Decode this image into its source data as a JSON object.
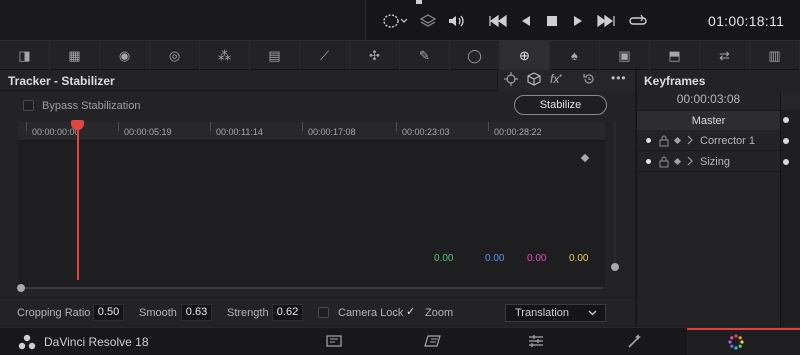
{
  "viewer": {
    "timecode": "01:00:18:11",
    "icons": [
      "loop-select-icon",
      "layers-icon",
      "volume-icon",
      "skip-to-start-icon",
      "previous-frame-icon",
      "stop-icon",
      "play-icon",
      "skip-to-end-icon",
      "loop-icon"
    ]
  },
  "toolbar": {
    "tools": [
      {
        "name": "camera-raw-icon",
        "glyph": "◨"
      },
      {
        "name": "color-match-icon",
        "glyph": "▦"
      },
      {
        "name": "primaries-icon",
        "glyph": "◉"
      },
      {
        "name": "hdr-icon",
        "glyph": "◎"
      },
      {
        "name": "rgb-mixer-icon",
        "glyph": "⁂"
      },
      {
        "name": "motion-effects-icon",
        "glyph": "▤"
      },
      {
        "name": "curves-icon",
        "glyph": "⟋"
      },
      {
        "name": "color-warper-icon",
        "glyph": "✣"
      },
      {
        "name": "qualifier-icon",
        "glyph": "✎"
      },
      {
        "name": "window-icon",
        "glyph": "◯"
      },
      {
        "name": "tracker-icon",
        "glyph": "⊕"
      },
      {
        "name": "magic-mask-icon",
        "glyph": "♠"
      },
      {
        "name": "blur-icon",
        "glyph": "▣"
      },
      {
        "name": "key-icon",
        "glyph": "⬒"
      },
      {
        "name": "sizing-icon",
        "glyph": "⇄"
      },
      {
        "name": "3d-icon",
        "glyph": "▥"
      }
    ],
    "active_index": 10
  },
  "tracker": {
    "title": "Tracker - Stabilizer",
    "bypass_label": "Bypass Stabilization",
    "stabilize_label": "Stabilize",
    "ruler": [
      "00:00:00:00",
      "00:00:05:19",
      "00:00:11:14",
      "00:00:17:08",
      "00:00:23:03",
      "00:00:28:22"
    ],
    "values": [
      {
        "value": "0.00",
        "color": "#4fc27a"
      },
      {
        "value": "0.00",
        "color": "#5b8ff0"
      },
      {
        "value": "0.00",
        "color": "#e24fb8"
      },
      {
        "value": "0.00",
        "color": "#e6c64a"
      }
    ],
    "header_icons": [
      "crosshair-icon",
      "cube-icon",
      "fx-icon",
      "reset-icon",
      "more-icon"
    ]
  },
  "controls": {
    "cropping_label": "Cropping Ratio",
    "cropping_value": "0.50",
    "smooth_label": "Smooth",
    "smooth_value": "0.63",
    "strength_label": "Strength",
    "strength_value": "0.62",
    "camera_lock_label": "Camera Lock",
    "camera_lock_checked": false,
    "zoom_label": "Zoom",
    "zoom_checked": true,
    "mode": "Translation"
  },
  "keyframes": {
    "title": "Keyframes",
    "time": "00:00:03:08",
    "master_label": "Master",
    "rows": [
      {
        "name": "Corrector 1"
      },
      {
        "name": "Sizing"
      }
    ]
  },
  "status": {
    "app_name": "DaVinci Resolve 18",
    "pages": [
      "media-page-icon",
      "cut-page-icon",
      "edit-page-icon",
      "fusion-page-icon",
      "color-page-icon"
    ],
    "active_page": "color-page-icon"
  }
}
